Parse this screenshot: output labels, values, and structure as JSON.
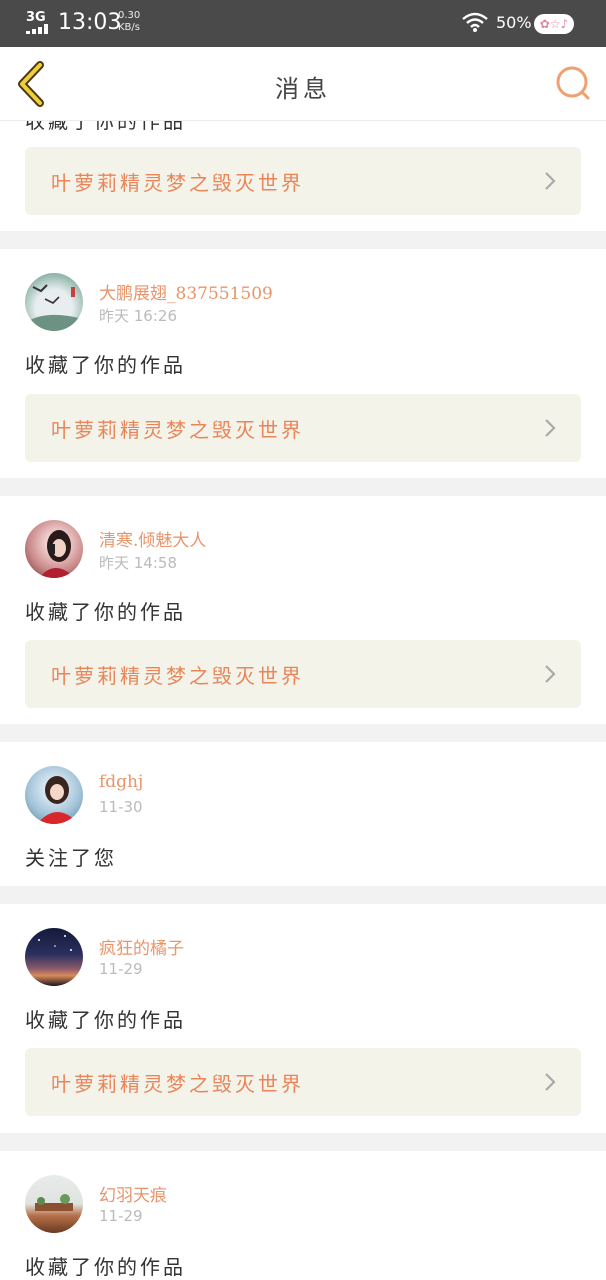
{
  "status_bar": {
    "network": "3G",
    "time": "13:03",
    "speed_value": "0.30",
    "speed_unit": "KB/s",
    "battery": "50%"
  },
  "nav": {
    "title": "消息"
  },
  "top_card": {
    "action": "收藏了你的作品",
    "work_title": "叶萝莉精灵梦之毁灭世界"
  },
  "messages": [
    {
      "username": "大鹏展翅_837551509",
      "time": "昨天 16:26",
      "action": "收藏了你的作品",
      "work_title": "叶萝莉精灵梦之毁灭世界"
    },
    {
      "username": "清寒.倾魅大人",
      "time": "昨天 14:58",
      "action": "收藏了你的作品",
      "work_title": "叶萝莉精灵梦之毁灭世界"
    },
    {
      "username": "fdghj",
      "time": "11-30",
      "action": "关注了您"
    },
    {
      "username": "疯狂的橘子",
      "time": "11-29",
      "action": "收藏了你的作品",
      "work_title": "叶萝莉精灵梦之毁灭世界"
    },
    {
      "username": "幻羽天痕",
      "time": "11-29",
      "action": "收藏了你的作品"
    }
  ],
  "colors": {
    "accent": "#e8956b",
    "work_bg": "#f3f3ea",
    "separator": "#f2f2f2",
    "status_bar": "#4a4a4a"
  },
  "icons": {
    "back": "back-chevron-icon",
    "search": "search-icon",
    "chevron": "chevron-right-icon",
    "wifi": "wifi-icon",
    "signal": "signal-icon",
    "battery": "battery-icon"
  }
}
